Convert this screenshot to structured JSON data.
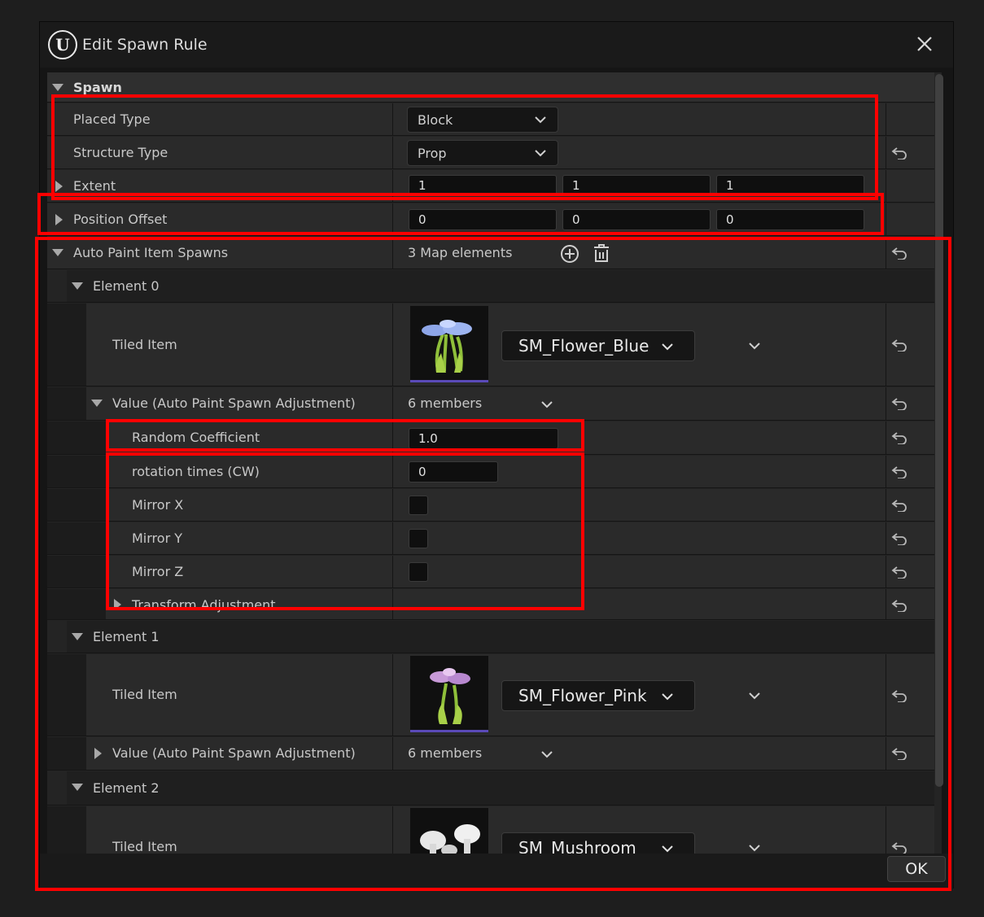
{
  "window": {
    "title": "Edit Spawn Rule",
    "logo_text": "U"
  },
  "spawn": {
    "category": "Spawn",
    "placed_type": {
      "label": "Placed Type",
      "value": "Block"
    },
    "structure_type": {
      "label": "Structure Type",
      "value": "Prop"
    },
    "extent": {
      "label": "Extent",
      "x": "1",
      "y": "1",
      "z": "1"
    },
    "position_offset": {
      "label": "Position Offset",
      "x": "0",
      "y": "0",
      "z": "0"
    }
  },
  "auto_paint": {
    "label": "Auto Paint Item Spawns",
    "summary": "3 Map elements",
    "elements": [
      {
        "label": "Element 0",
        "tiled_item_label": "Tiled Item",
        "asset": "SM_Flower_Blue",
        "value_label": "Value (Auto Paint Spawn Adjustment)",
        "members": "6 members",
        "random_coefficient": {
          "label": "Random Coefficient",
          "value": "1.0"
        },
        "rotation_times": {
          "label": "rotation times (CW)",
          "value": "0"
        },
        "mirror_x": {
          "label": "Mirror X",
          "checked": false
        },
        "mirror_y": {
          "label": "Mirror Y",
          "checked": false
        },
        "mirror_z": {
          "label": "Mirror Z",
          "checked": false
        },
        "transform_adjustment": {
          "label": "Transform Adjustment"
        }
      },
      {
        "label": "Element 1",
        "tiled_item_label": "Tiled Item",
        "asset": "SM_Flower_Pink",
        "value_label": "Value (Auto Paint Spawn Adjustment)",
        "members": "6 members"
      },
      {
        "label": "Element 2",
        "tiled_item_label": "Tiled Item",
        "asset": "SM_Mushroom"
      }
    ]
  },
  "footer": {
    "ok_label": "OK"
  },
  "colors": {
    "highlight": "#ff0000",
    "panel": "#242424",
    "thumb_underline": "#5a4ab8"
  }
}
